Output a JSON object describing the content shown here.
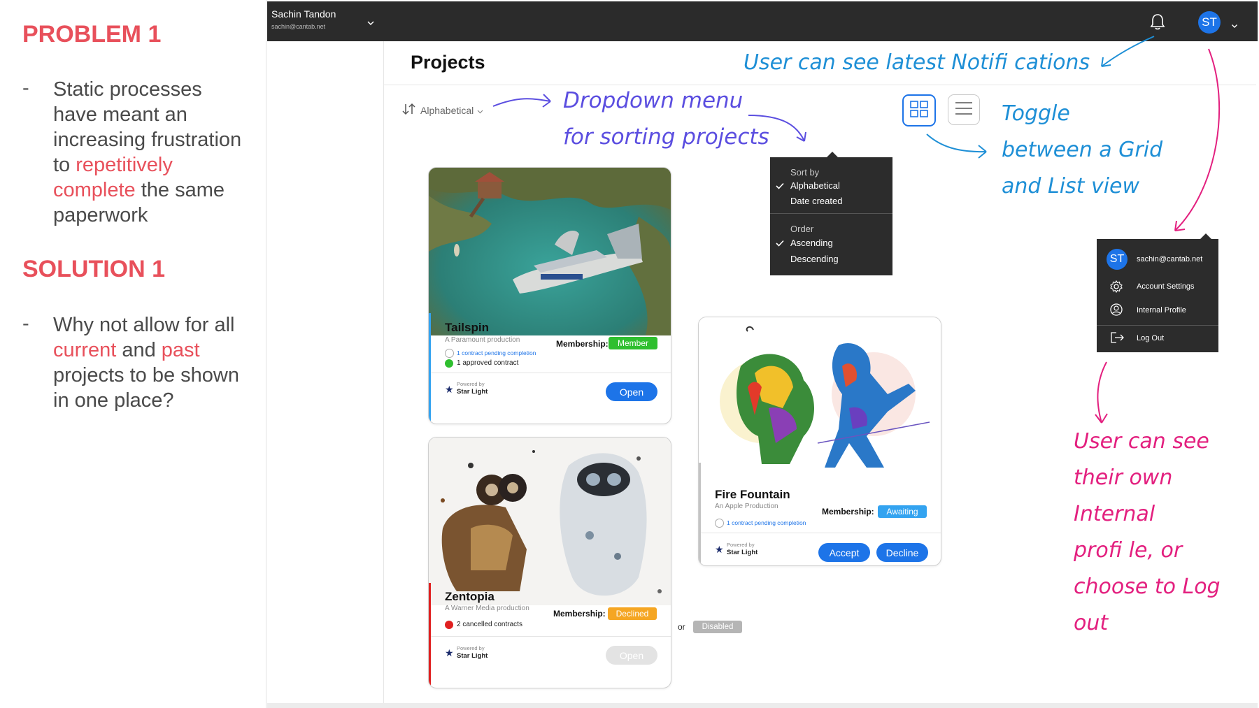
{
  "left": {
    "problem_heading": "PROBLEM 1",
    "problem_dash": "-",
    "problem_lines": [
      "Static processes",
      "have meant an",
      "increasing frustration",
      "to",
      "repetitively",
      "complete",
      "the same",
      "paperwork"
    ],
    "solution_heading": "SOLUTION 1",
    "solution_dash": "-",
    "solution_lines": [
      "Why not allow for all",
      "current",
      "and",
      "past",
      "projects to be shown",
      "in one place?"
    ]
  },
  "topbar": {
    "user_name": "Sachin Tandon",
    "user_email": "sachin@cantab.net",
    "avatar_initials": "ST"
  },
  "page": {
    "title": "Projects",
    "sort_label": "Alphabetical"
  },
  "dropdown": {
    "sort_by_label": "Sort by",
    "sort_options": [
      "Alphabetical",
      "Date created"
    ],
    "order_label": "Order",
    "order_options": [
      "Ascending",
      "Descending"
    ]
  },
  "account_menu": {
    "avatar_initials": "ST",
    "email": "sachin@cantab.net",
    "items": [
      "Account Settings",
      "Internal Profile",
      "Log Out"
    ]
  },
  "cards": {
    "tailspin": {
      "title": "Tailspin",
      "subtitle": "A Paramount production",
      "membership_label": "Membership:",
      "badge": "Member",
      "pending": "1 contract pending completion",
      "status": "1 approved contract",
      "powered_by": "Powered by",
      "brand": "Star Light",
      "button": "Open"
    },
    "zentopia": {
      "title": "Zentopia",
      "subtitle": "A Warner Media production",
      "membership_label": "Membership:",
      "badge": "Declined",
      "status": "2 cancelled contracts",
      "powered_by": "Powered by",
      "brand": "Star Light",
      "button": "Open"
    },
    "firefountain": {
      "title": "Fire Fountain",
      "subtitle": "An Apple  Production",
      "membership_label": "Membership:",
      "badge": "Awaiting",
      "pending": "1 contract pending completion",
      "powered_by": "Powered by",
      "brand": "Star Light",
      "accept": "Accept",
      "decline": "Decline"
    }
  },
  "or_label": "or",
  "disabled_badge": "Disabled",
  "annotations": {
    "notifications": "User can see latest Notifi cations",
    "dropdown_line1": "Dropdown menu",
    "dropdown_line2": "for sorting projects",
    "toggle_line1": "Toggle",
    "toggle_line2": "between a Grid",
    "toggle_line3": "and List view",
    "profile_lines": [
      "User can see",
      "their own",
      "Internal",
      "profi le, or",
      "choose to Log",
      "out"
    ]
  },
  "colors": {
    "accent_red": "#e8505b",
    "primary_blue": "#1d74e8",
    "member_green": "#2fbf2f",
    "declined_orange": "#f5a623",
    "awaiting_blue": "#33a3f0",
    "annotation_blue": "#1e8fd6",
    "annotation_pink": "#e3207f"
  }
}
